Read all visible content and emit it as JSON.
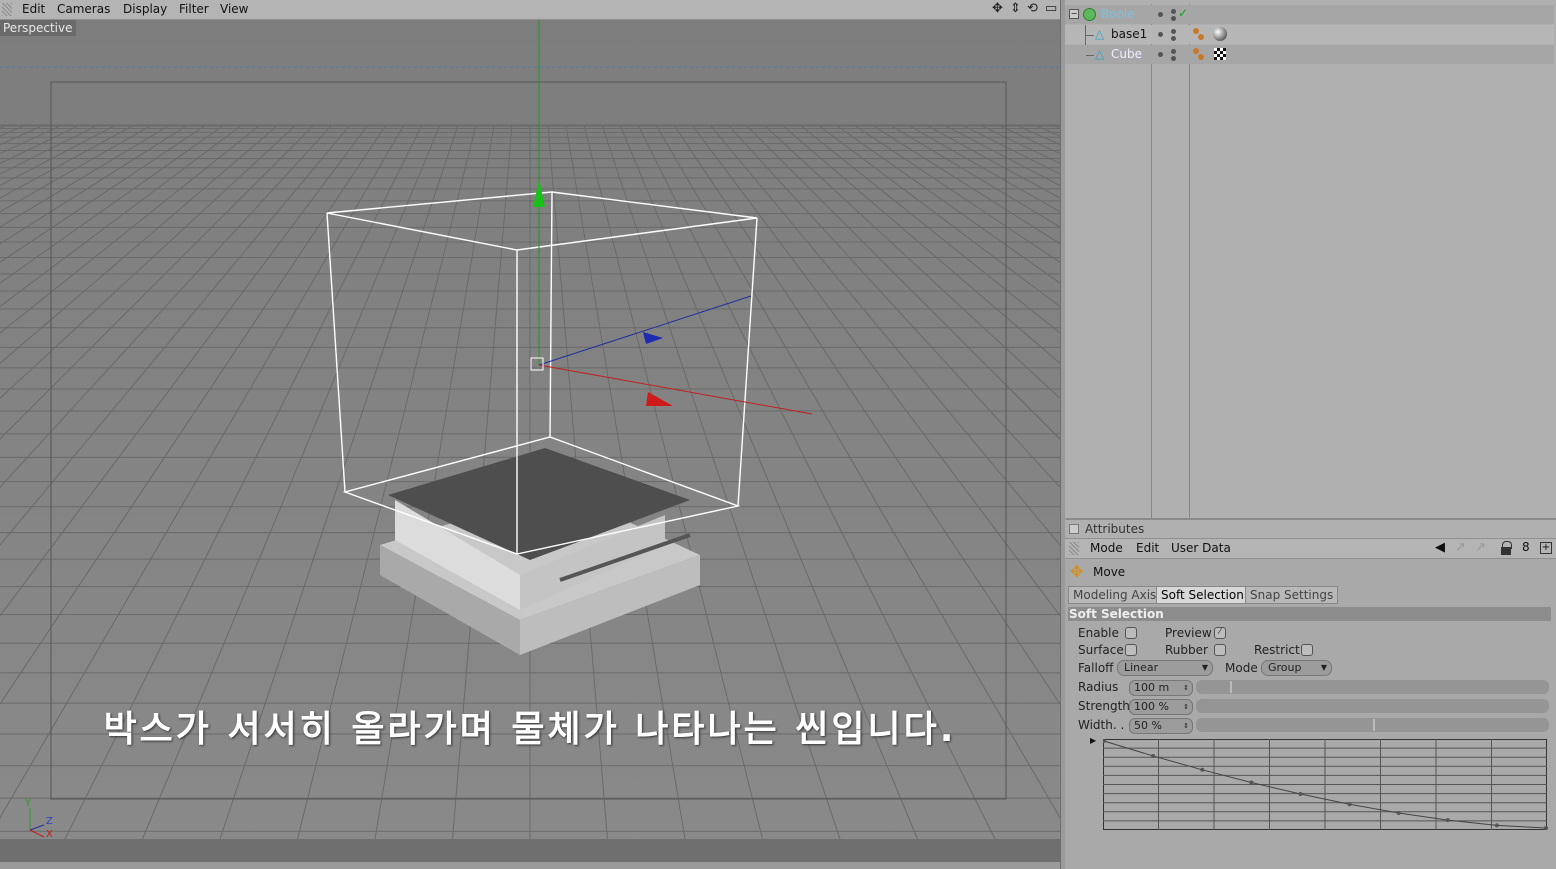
{
  "viewport": {
    "menu": [
      "Edit",
      "Cameras",
      "Display",
      "Filter",
      "View"
    ],
    "camera_label": "Perspective",
    "subtitle": "박스가 서서히 올라가며 물체가 나타나는 씬입니다.",
    "axis_labels": {
      "y": "Y",
      "z": "Z",
      "x": "X"
    }
  },
  "object_manager": {
    "objects": [
      {
        "name": "Boole",
        "icon": "boole-icon",
        "color": "#7fc0d8"
      },
      {
        "name": "base1",
        "icon": "polygon-object-icon"
      },
      {
        "name": "Cube",
        "icon": "polygon-object-icon"
      }
    ]
  },
  "attributes": {
    "title": "Attributes",
    "menu": [
      "Mode",
      "Edit",
      "User Data"
    ],
    "tool_name": "Move",
    "tabs": [
      "Modeling Axis",
      "Soft Selection",
      "Snap Settings"
    ],
    "active_tab": "Soft Selection",
    "section_title": "Soft Selection",
    "labels": {
      "enable": "Enable",
      "preview": "Preview",
      "surface": "Surface",
      "rubber": "Rubber",
      "restrict": "Restrict",
      "falloff": "Falloff",
      "mode": "Mode",
      "radius": "Radius",
      "strength": "Strength",
      "width": "Width. . ."
    },
    "falloff_value": "Linear",
    "mode_value": "Group",
    "radius_value": "100 m",
    "strength_value": "100 %",
    "width_value": "50 %",
    "preview_checked": true,
    "colors": {
      "accent_green": "#18a018",
      "axis_red": "#d03030",
      "axis_blue": "#2040b0"
    }
  }
}
